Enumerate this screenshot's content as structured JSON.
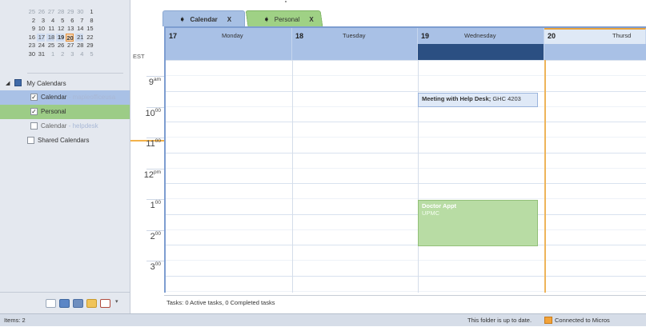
{
  "mini_calendar": {
    "rows": [
      [
        {
          "d": "25",
          "dim": true
        },
        {
          "d": "26",
          "dim": true
        },
        {
          "d": "27",
          "dim": true
        },
        {
          "d": "28",
          "dim": true
        },
        {
          "d": "29",
          "dim": true
        },
        {
          "d": "30",
          "dim": true
        },
        {
          "d": "1"
        }
      ],
      [
        {
          "d": "2"
        },
        {
          "d": "3"
        },
        {
          "d": "4"
        },
        {
          "d": "5"
        },
        {
          "d": "6"
        },
        {
          "d": "7"
        },
        {
          "d": "8"
        }
      ],
      [
        {
          "d": "9"
        },
        {
          "d": "10"
        },
        {
          "d": "11"
        },
        {
          "d": "12"
        },
        {
          "d": "13"
        },
        {
          "d": "14"
        },
        {
          "d": "15"
        }
      ],
      [
        {
          "d": "16"
        },
        {
          "d": "17",
          "sel": true
        },
        {
          "d": "18",
          "sel": true
        },
        {
          "d": "19",
          "sel": true,
          "bold": true
        },
        {
          "d": "20",
          "today": true
        },
        {
          "d": "21",
          "sel": true
        },
        {
          "d": "22"
        }
      ],
      [
        {
          "d": "23"
        },
        {
          "d": "24"
        },
        {
          "d": "25"
        },
        {
          "d": "26"
        },
        {
          "d": "27"
        },
        {
          "d": "28"
        },
        {
          "d": "29"
        }
      ],
      [
        {
          "d": "30"
        },
        {
          "d": "31"
        },
        {
          "d": "1",
          "dim": true
        },
        {
          "d": "2",
          "dim": true
        },
        {
          "d": "3",
          "dim": true
        },
        {
          "d": "4",
          "dim": true
        },
        {
          "d": "5",
          "dim": true
        }
      ]
    ]
  },
  "calendars": {
    "group_label": "My Calendars",
    "items": [
      {
        "label": "Calendar",
        "sub": " - mapleofficeusa",
        "checked": true,
        "style": "blue"
      },
      {
        "label": "Personal",
        "sub": "",
        "checked": true,
        "style": "green"
      },
      {
        "label": "Calendar",
        "sub": " - helpdesk",
        "checked": false,
        "style": ""
      }
    ],
    "shared_label": "Shared Calendars"
  },
  "tabs": [
    {
      "label": "Calendar",
      "close": "X"
    },
    {
      "label": "Personal",
      "close": "X"
    }
  ],
  "timezone": "EST",
  "times": [
    {
      "h": "9",
      "m": "am"
    },
    {
      "h": "10",
      "m": "00"
    },
    {
      "h": "11",
      "m": "00"
    },
    {
      "h": "12",
      "m": "pm"
    },
    {
      "h": "1",
      "m": "00"
    },
    {
      "h": "2",
      "m": "00"
    },
    {
      "h": "3",
      "m": "00"
    }
  ],
  "days": [
    {
      "num": "17",
      "name": "Monday"
    },
    {
      "num": "18",
      "name": "Tuesday"
    },
    {
      "num": "19",
      "name": "Wednesday"
    },
    {
      "num": "20",
      "name": "Thursd"
    }
  ],
  "appointments": [
    {
      "title": "Meeting with Help Desk;",
      "location": " GHC 4203"
    },
    {
      "title": "Doctor Appt",
      "location": "UPMC"
    }
  ],
  "tasks_bar": "Tasks: 0 Active tasks, 0 Completed tasks",
  "status": {
    "items": "Items: 2",
    "up_to_date": "This folder is up to date.",
    "connected": "Connected to Micros"
  },
  "colors": {
    "header_blue": "#a9c1e6",
    "personal_green": "#9ccc86",
    "allday_block": "#2b4f82",
    "today_orange": "#e8a23c"
  }
}
